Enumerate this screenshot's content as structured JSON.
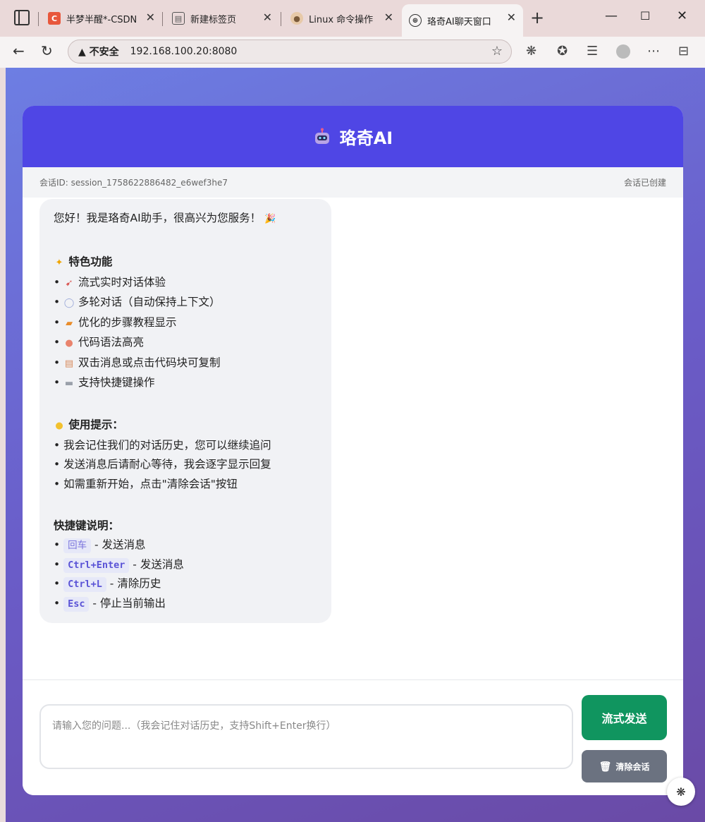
{
  "browser": {
    "tabs": [
      {
        "title": "半梦半醒*-CSDN",
        "favicon": "csdn-icon",
        "active": false
      },
      {
        "title": "新建标签页",
        "favicon": "new-tab-icon",
        "active": false
      },
      {
        "title": "Linux 命令操作",
        "favicon": "linux-icon",
        "active": false
      },
      {
        "title": "珞奇AI聊天窗口",
        "favicon": "globe-icon",
        "active": true
      }
    ],
    "security_label": "不安全",
    "url": "192.168.100.20:8080"
  },
  "app": {
    "title": "珞奇AI",
    "session_id": "会话ID: session_1758622886482_e6wef3he7",
    "session_status": "会话已创建"
  },
  "message": {
    "greeting": "您好！我是珞奇AI助手，很高兴为您服务！",
    "features_title": "特色功能",
    "features": [
      {
        "icon": "rocket-icon",
        "text": "流式实时对话体验"
      },
      {
        "icon": "speech-bubble-icon",
        "text": "多轮对话（自动保持上下文）"
      },
      {
        "icon": "memo-icon",
        "text": "优化的步骤教程显示"
      },
      {
        "icon": "palette-icon",
        "text": "代码语法高亮"
      },
      {
        "icon": "clipboard-icon",
        "text": "双击消息或点击代码块可复制"
      },
      {
        "icon": "keyboard-icon",
        "text": "支持快捷键操作"
      }
    ],
    "tips_title": "使用提示：",
    "tips": [
      "我会记住我们的对话历史，您可以继续追问",
      "发送消息后请耐心等待，我会逐字显示回复",
      "如需重新开始，点击\"清除会话\"按钮"
    ],
    "shortcuts_title": "快捷键说明：",
    "shortcuts": [
      {
        "key": "回车",
        "desc": "- 发送消息"
      },
      {
        "key": "Ctrl+Enter",
        "desc": "- 发送消息"
      },
      {
        "key": "Ctrl+L",
        "desc": "- 清除历史"
      },
      {
        "key": "Esc",
        "desc": "- 停止当前输出"
      }
    ]
  },
  "input": {
    "placeholder": "请输入您的问题...（我会记住对话历史，支持Shift+Enter换行）",
    "value": ""
  },
  "buttons": {
    "send": "流式发送",
    "clear": "清除会话"
  },
  "colors": {
    "header": "#4f46e5",
    "send": "#10955f",
    "clear": "#6b7280"
  }
}
